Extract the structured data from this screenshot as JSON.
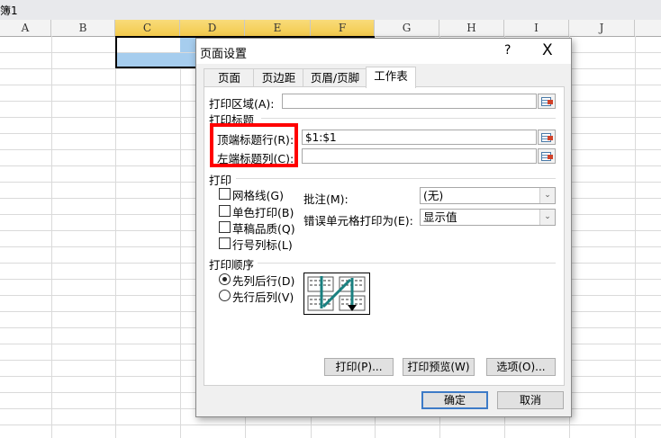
{
  "window": {
    "title": "簿1"
  },
  "columns": [
    "A",
    "B",
    "C",
    "D",
    "E",
    "F",
    "G",
    "H",
    "I",
    "J"
  ],
  "dialog": {
    "title": "页面设置",
    "help": "?",
    "close": "X",
    "tabs": [
      "页面",
      "页边距",
      "页眉/页脚",
      "工作表"
    ],
    "active_tab": "工作表",
    "print_area": {
      "label": "打印区域(A):",
      "value": ""
    },
    "print_titles": {
      "heading": "打印标题",
      "rows": {
        "label": "顶端标题行(R):",
        "value": "$1:$1"
      },
      "cols": {
        "label": "左端标题列(C):",
        "value": ""
      }
    },
    "print": {
      "heading": "打印",
      "checkboxes": [
        {
          "label": "网格线(G)",
          "checked": false
        },
        {
          "label": "单色打印(B)",
          "checked": false
        },
        {
          "label": "草稿品质(Q)",
          "checked": false
        },
        {
          "label": "行号列标(L)",
          "checked": false
        }
      ],
      "comments": {
        "label": "批注(M):",
        "value": "(无)"
      },
      "errors": {
        "label": "错误单元格打印为(E):",
        "value": "显示值"
      }
    },
    "order": {
      "heading": "打印顺序",
      "options": [
        {
          "label": "先列后行(D)",
          "selected": true
        },
        {
          "label": "先行后列(V)",
          "selected": false
        }
      ]
    },
    "buttons": {
      "print": "打印(P)...",
      "preview": "打印预览(W)",
      "options": "选项(O)...",
      "ok": "确定",
      "cancel": "取消"
    },
    "highlight_color": "#ff0000"
  }
}
